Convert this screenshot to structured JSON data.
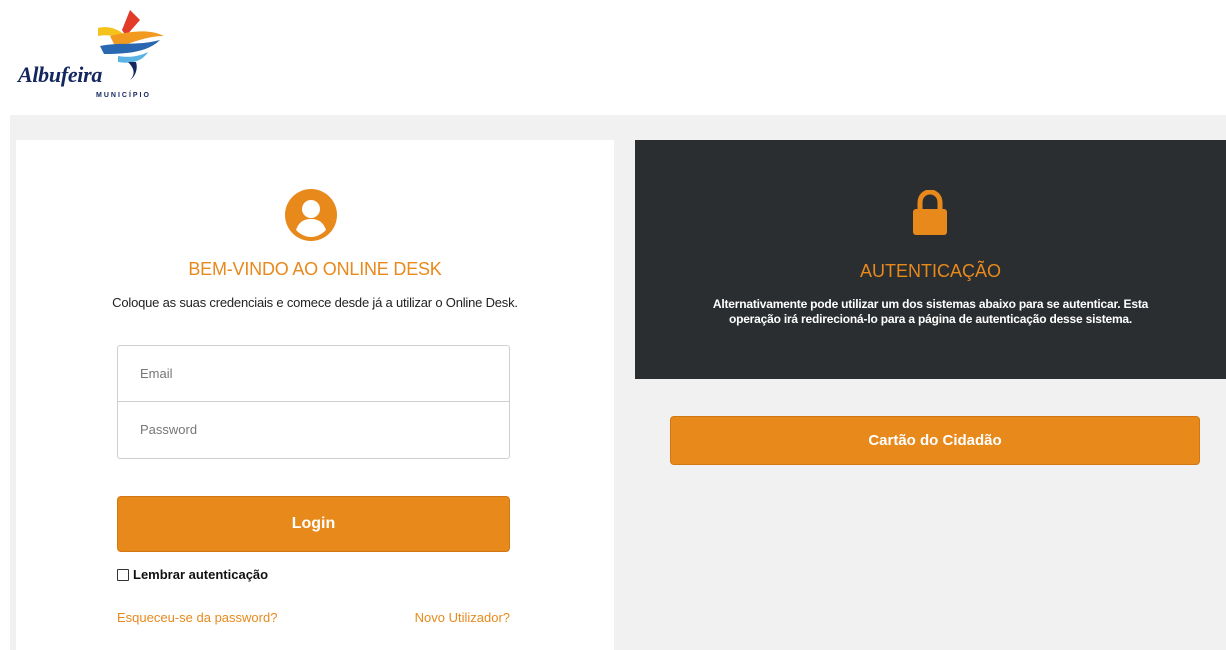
{
  "header": {
    "logo": {
      "name": "Albufeira",
      "subtitle": "MUNICÍPIO"
    }
  },
  "login": {
    "title": "BEM-VINDO AO ONLINE DESK",
    "subtitle": "Coloque as suas credenciais e comece desde já a utilizar o Online Desk.",
    "email_placeholder": "Email",
    "password_placeholder": "Password",
    "login_label": "Login",
    "remember_label": "Lembrar autenticação",
    "remember_checked": false,
    "forgot_link": "Esqueceu-se da password?",
    "new_user_link": "Novo Utilizador?"
  },
  "auth": {
    "title": "AUTENTICAÇÃO",
    "description": "Alternativamente pode utilizar um dos sistemas abaixo para se autenticar. Esta operação irá redirecioná-lo para a página de autenticação desse sistema.",
    "citizen_card_label": "Cartão do Cidadão"
  },
  "icons": {
    "user": "user-circle-icon",
    "lock": "lock-icon"
  },
  "colors": {
    "accent": "#e8891c",
    "dark_panel": "#2b2e30",
    "background": "#f1f1f1",
    "logo_text": "#13275e"
  }
}
